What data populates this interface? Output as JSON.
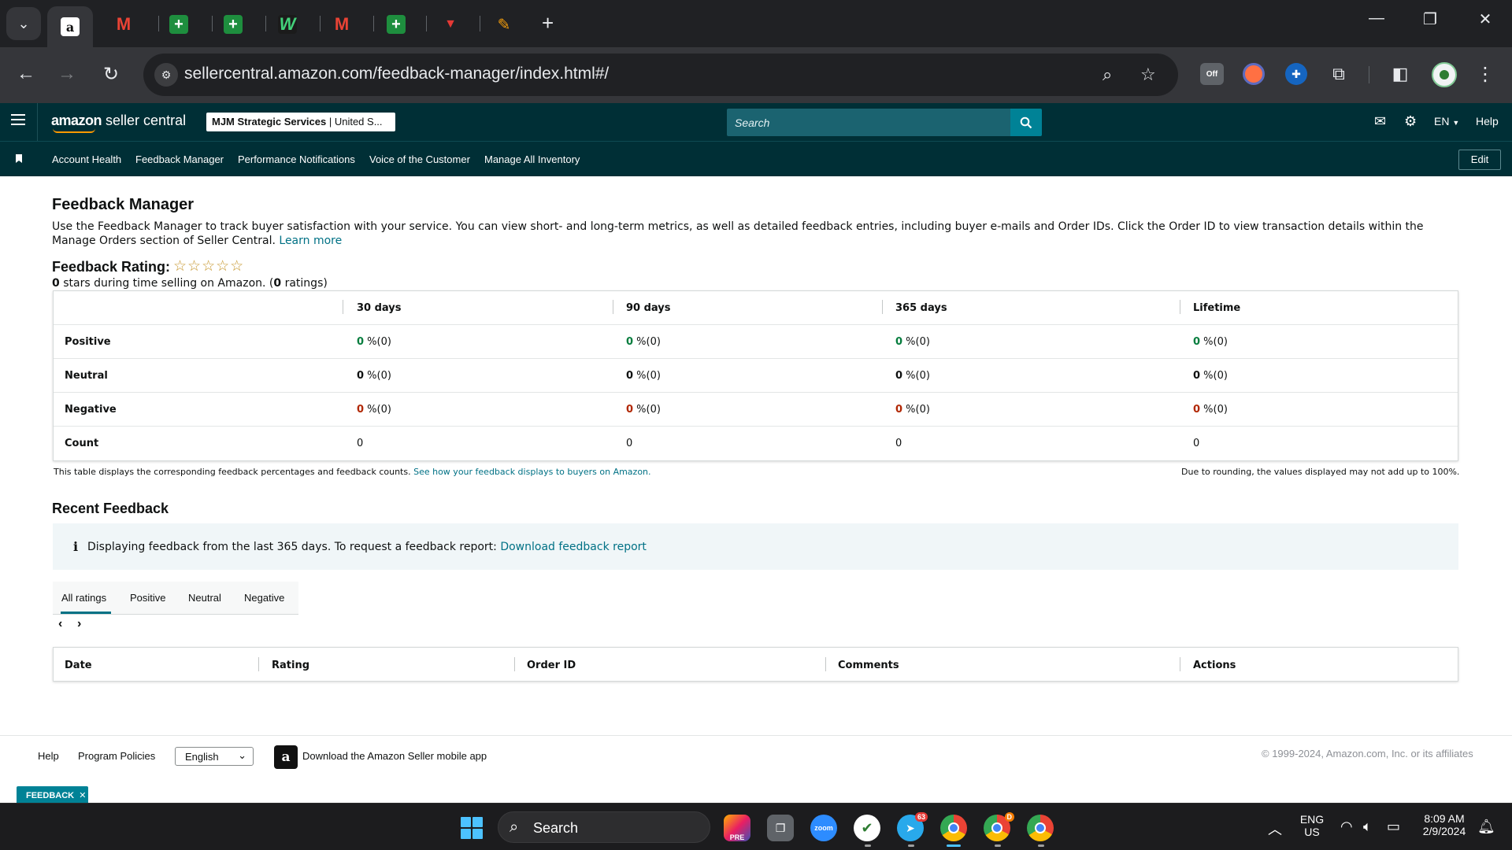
{
  "browser": {
    "tabs": [
      {
        "icon": "amazon-icon",
        "active": true
      },
      {
        "icon": "gmail-icon"
      },
      {
        "icon": "sheets-icon"
      },
      {
        "icon": "sheets-icon"
      },
      {
        "icon": "w-app-icon"
      },
      {
        "icon": "gmail-icon"
      },
      {
        "icon": "sheets-icon"
      },
      {
        "icon": "red-app-icon"
      },
      {
        "icon": "multicolor-app-icon"
      }
    ],
    "url": "sellercentral.amazon.com/feedback-manager/index.html#/",
    "extension_off_label": "Off"
  },
  "header": {
    "logo_amazon": "amazon",
    "logo_suffix": " seller central",
    "account_name": "MJM Strategic Services",
    "account_region": " | United S...",
    "search_placeholder": "Search",
    "language": "EN",
    "help": "Help"
  },
  "nav": {
    "items": [
      "Account Health",
      "Feedback Manager",
      "Performance Notifications",
      "Voice of the Customer",
      "Manage All Inventory"
    ],
    "edit_label": "Edit"
  },
  "page": {
    "title": "Feedback Manager",
    "description": "Use the Feedback Manager to track buyer satisfaction with your service. You can view short- and long-term metrics, as well as detailed feedback entries, including buyer e-mails and Order IDs. Click the Order ID to view transaction details within the Manage Orders section of Seller Central.",
    "learn_more": "Learn more",
    "rating_label": "Feedback Rating:",
    "rating_stars": "☆☆☆☆☆",
    "rating_value": "0",
    "rating_mid": " stars during time selling on Amazon. (",
    "rating_count": "0",
    "rating_end": " ratings)"
  },
  "feedback_table": {
    "columns": [
      "30 days",
      "90 days",
      "365 days",
      "Lifetime"
    ],
    "rows": [
      {
        "label": "Positive",
        "values": [
          "0",
          "0",
          "0",
          "0"
        ],
        "suffix": " %(0)",
        "color": "#067d3e"
      },
      {
        "label": "Neutral",
        "values": [
          "0",
          "0",
          "0",
          "0"
        ],
        "suffix": " %(0)",
        "color": "#0f1111"
      },
      {
        "label": "Negative",
        "values": [
          "0",
          "0",
          "0",
          "0"
        ],
        "suffix": " %(0)",
        "color": "#b12704"
      }
    ],
    "count_label": "Count",
    "counts": [
      "0",
      "0",
      "0",
      "0"
    ],
    "note_left": "This table displays the corresponding feedback percentages and feedback counts.",
    "note_link": "See how your feedback displays to buyers on Amazon.",
    "note_right": "Due to rounding, the values displayed may not add up to 100%."
  },
  "recent": {
    "title": "Recent Feedback",
    "info_text": "Displaying feedback from the last 365 days. To request a feedback report:",
    "info_link": "Download feedback report",
    "tabs": [
      "All ratings",
      "Positive",
      "Neutral",
      "Negative"
    ],
    "active_tab": "All ratings",
    "columns": [
      "Date",
      "Rating",
      "Order ID",
      "Comments",
      "Actions"
    ]
  },
  "footer": {
    "help": "Help",
    "policies": "Program Policies",
    "language": "English",
    "app_text": "Download the Amazon Seller mobile app",
    "copyright": "© 1999-2024, Amazon.com, Inc. or its affiliates",
    "feedback_pill": "FEEDBACK"
  },
  "taskbar": {
    "search": "Search",
    "lang_top": "ENG",
    "lang_bottom": "US",
    "time": "8:09 AM",
    "date": "2/9/2024",
    "telegram_badge": "63",
    "chrome_badge": "D",
    "zoom_label": "zoom",
    "pre_label": "PRE"
  },
  "colors": {
    "header_bg": "#002f36",
    "link": "#007185",
    "positive": "#067d3e",
    "negative": "#b12704",
    "taskbar_accent": "#4cc2ff"
  }
}
